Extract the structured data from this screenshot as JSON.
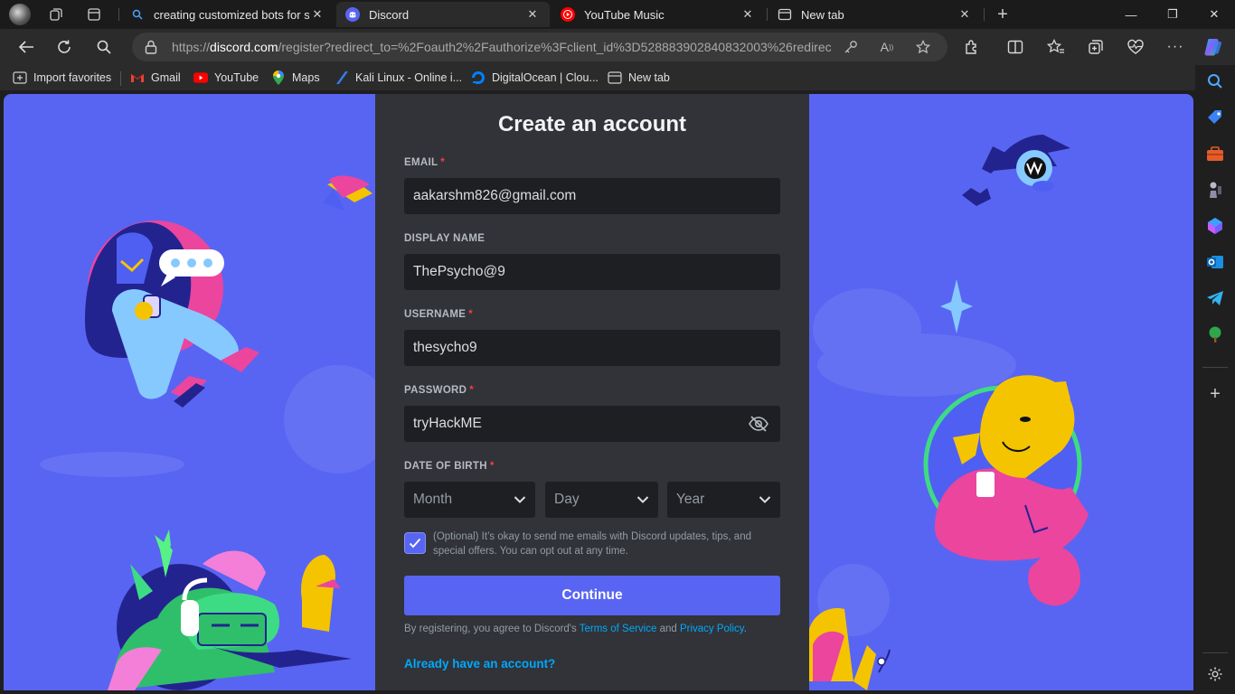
{
  "tabs": [
    {
      "title": "creating customized bots for self",
      "icon": "search-icon",
      "active": false
    },
    {
      "title": "Discord",
      "icon": "discord-icon",
      "active": true
    },
    {
      "title": "YouTube Music",
      "icon": "youtube-music-icon",
      "active": false
    },
    {
      "title": "New tab",
      "icon": "new-tab-icon",
      "active": false
    }
  ],
  "window_controls": {
    "minimize": "—",
    "restore": "❐",
    "close": "✕"
  },
  "address_bar": {
    "url_prefix": "https://",
    "url_host": "discord.com",
    "url_path": "/register?redirect_to=%2Foauth2%2Fauthorize%3Fclient_id%3D528883902840832003%26redirec..."
  },
  "favorites": [
    {
      "label": "Import favorites",
      "icon": "import-icon"
    },
    {
      "label": "Gmail",
      "icon": "gmail-icon"
    },
    {
      "label": "YouTube",
      "icon": "youtube-icon"
    },
    {
      "label": "Maps",
      "icon": "maps-icon"
    },
    {
      "label": "Kali Linux - Online i...",
      "icon": "kali-icon"
    },
    {
      "label": "DigitalOcean | Clou...",
      "icon": "digitalocean-icon"
    },
    {
      "label": "New tab",
      "icon": "new-tab-icon"
    }
  ],
  "form": {
    "title": "Create an account",
    "email_label": "EMAIL",
    "email_value": "aakarshm826@gmail.com",
    "display_name_label": "DISPLAY NAME",
    "display_name_value": "ThePsycho@9",
    "username_label": "USERNAME",
    "username_value": "thesycho9",
    "password_label": "PASSWORD",
    "password_value": "tryHackME",
    "dob_label": "DATE OF BIRTH",
    "required_mark": "*",
    "month_placeholder": "Month",
    "day_placeholder": "Day",
    "year_placeholder": "Year",
    "optin_checked": true,
    "optin_text": "(Optional) It’s okay to send me emails with Discord updates, tips, and special offers. You can opt out at any time.",
    "continue_label": "Continue",
    "legal_prefix": "By registering, you agree to Discord's ",
    "tos_label": "Terms of Service",
    "legal_and": " and ",
    "privacy_label": "Privacy Policy",
    "legal_suffix": ".",
    "login_link": "Already have an account?"
  },
  "colors": {
    "blurple": "#5865f2",
    "card_bg": "#313338",
    "input_bg": "#1e1f22",
    "link": "#00a8fc",
    "required": "#f23f43"
  }
}
